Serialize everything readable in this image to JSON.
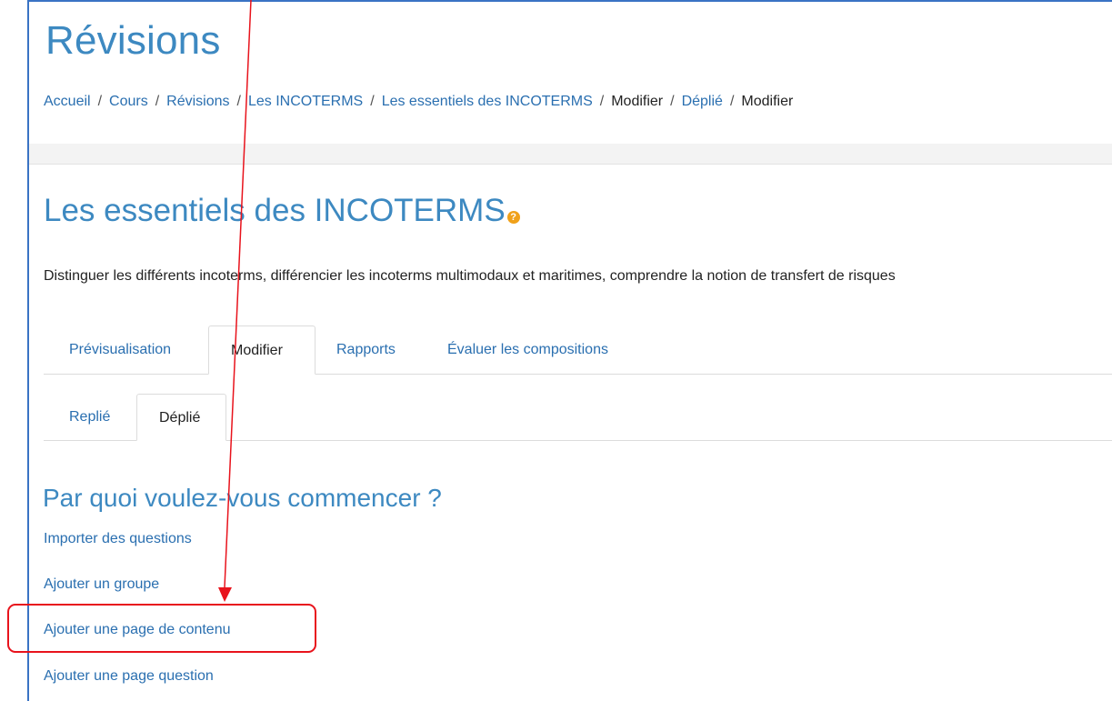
{
  "site": {
    "title": "Révisions"
  },
  "breadcrumb": [
    {
      "label": "Accueil",
      "link": true
    },
    {
      "label": "Cours",
      "link": true
    },
    {
      "label": "Révisions",
      "link": true
    },
    {
      "label": "Les INCOTERMS",
      "link": true
    },
    {
      "label": "Les essentiels des INCOTERMS",
      "link": true
    },
    {
      "label": "Modifier",
      "link": false
    },
    {
      "label": "Déplié",
      "link": true
    },
    {
      "label": "Modifier",
      "link": false
    }
  ],
  "breadcrumb_separator": "/",
  "page": {
    "heading": "Les essentiels des INCOTERMS",
    "help_icon_glyph": "?",
    "description": "Distinguer les différents incoterms, différencier les incoterms multimodaux et maritimes, comprendre la notion de transfert de risques"
  },
  "tabs": [
    {
      "label": "Prévisualisation",
      "active": false
    },
    {
      "label": "Modifier",
      "active": true
    },
    {
      "label": "Rapports",
      "active": false
    },
    {
      "label": "Évaluer les compositions",
      "active": false
    }
  ],
  "subtabs": [
    {
      "label": "Replié",
      "active": false
    },
    {
      "label": "Déplié",
      "active": true
    }
  ],
  "start": {
    "heading": "Par quoi voulez-vous commencer ?",
    "links": [
      "Importer des questions",
      "Ajouter un groupe",
      "Ajouter une page de contenu",
      "Ajouter une page question"
    ]
  },
  "colors": {
    "accent": "#3d89c1",
    "link": "#2a6fb0",
    "annotation": "#e8131c",
    "help_icon": "#f0a11a"
  }
}
